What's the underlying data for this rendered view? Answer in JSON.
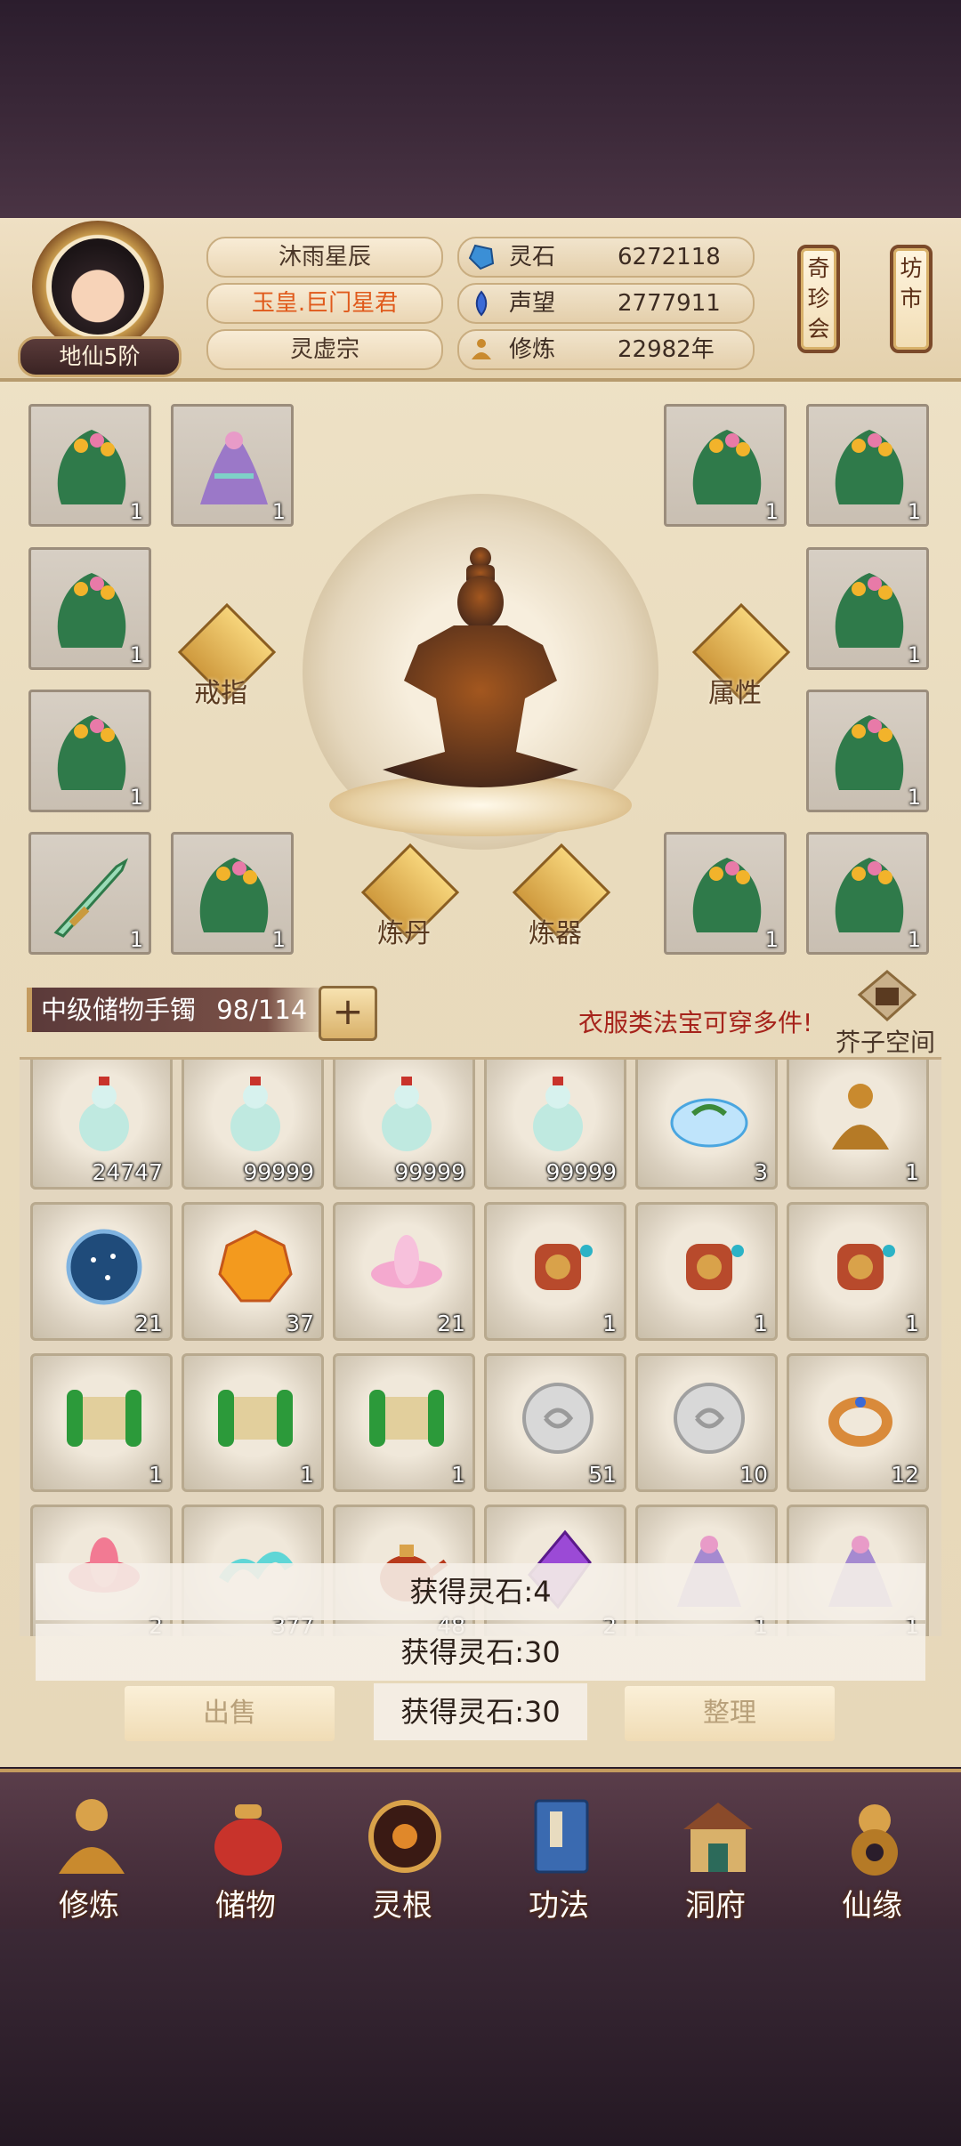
{
  "player": {
    "realm": "地仙5阶",
    "name": "沐雨星辰",
    "title": "玉皇.巨门星君",
    "sect": "灵虚宗"
  },
  "stats": [
    {
      "label": "灵石",
      "value": "6272118",
      "icon": "spirit-stone-icon",
      "color": "#3b8fd6"
    },
    {
      "label": "声望",
      "value": "2777911",
      "icon": "prestige-icon",
      "color": "#3b6ad6"
    },
    {
      "label": "修炼",
      "value": "22982年",
      "icon": "meditation-icon",
      "color": "#c98a2e"
    }
  ],
  "top_buttons": [
    {
      "label": "奇珍会"
    },
    {
      "label": "坊市"
    }
  ],
  "equipment": {
    "left_slots": [
      {
        "count": "1"
      },
      {
        "count": "1"
      },
      {
        "count": "1"
      },
      {
        "count": "1"
      },
      {
        "count": "1"
      },
      {
        "count": "1"
      }
    ],
    "right_slots": [
      {
        "count": "1"
      },
      {
        "count": "1"
      },
      {
        "count": "1"
      },
      {
        "count": "1"
      },
      {
        "count": "1"
      },
      {
        "count": "1"
      }
    ],
    "ring_label": "戒指",
    "attr_label": "属性",
    "alchemy_label": "炼丹",
    "forge_label": "炼器"
  },
  "bag": {
    "name": "中级储物手镯",
    "capacity": "98/114",
    "notice": "衣服类法宝可穿多件!",
    "space_label": "芥子空间"
  },
  "items": [
    {
      "count": "24747",
      "icon": "potion-gourd-icon"
    },
    {
      "count": "99999",
      "icon": "potion-gourd-icon"
    },
    {
      "count": "99999",
      "icon": "potion-gourd-icon"
    },
    {
      "count": "99999",
      "icon": "potion-gourd-icon"
    },
    {
      "count": "3",
      "icon": "herb-bowl-icon"
    },
    {
      "count": "1",
      "icon": "buddha-statue-icon"
    },
    {
      "count": "21",
      "icon": "star-disc-icon"
    },
    {
      "count": "37",
      "icon": "amber-gem-icon"
    },
    {
      "count": "21",
      "icon": "lotus-icon"
    },
    {
      "count": "1",
      "icon": "drum-artifact-icon"
    },
    {
      "count": "1",
      "icon": "drum-artifact-icon"
    },
    {
      "count": "1",
      "icon": "drum-artifact-icon"
    },
    {
      "count": "1",
      "icon": "jade-scroll-icon"
    },
    {
      "count": "1",
      "icon": "jade-scroll-icon"
    },
    {
      "count": "1",
      "icon": "jade-scroll-icon"
    },
    {
      "count": "51",
      "icon": "silver-coin-icon"
    },
    {
      "count": "10",
      "icon": "silver-coin-icon"
    },
    {
      "count": "12",
      "icon": "gold-ring-icon"
    },
    {
      "count": "2",
      "icon": "red-lotus-icon"
    },
    {
      "count": "377",
      "icon": "cloud-wisp-icon"
    },
    {
      "count": "48",
      "icon": "teapot-icon"
    },
    {
      "count": "2",
      "icon": "purple-crystal-icon"
    },
    {
      "count": "1",
      "icon": "fairy-robe-icon"
    },
    {
      "count": "1",
      "icon": "fairy-robe-icon"
    }
  ],
  "toasts": [
    "获得灵石:4",
    "获得灵石:30",
    "获得灵石:30"
  ],
  "actions": {
    "sell": "出售",
    "sort": "整理"
  },
  "nav": [
    {
      "label": "修炼",
      "icon": "cultivate-icon"
    },
    {
      "label": "储物",
      "icon": "storage-bag-icon"
    },
    {
      "label": "灵根",
      "icon": "spirit-root-icon"
    },
    {
      "label": "功法",
      "icon": "technique-book-icon"
    },
    {
      "label": "洞府",
      "icon": "cave-dwelling-icon"
    },
    {
      "label": "仙缘",
      "icon": "immortal-fate-icon"
    }
  ]
}
